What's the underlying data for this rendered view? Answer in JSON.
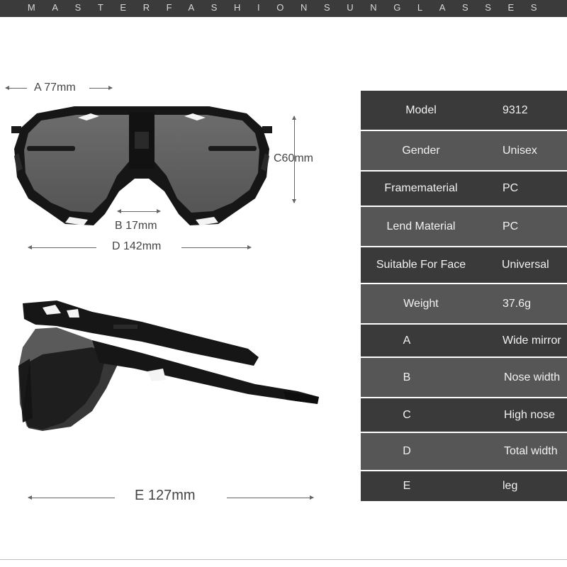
{
  "header": {
    "brand": "MASTERFASHIONSUNGLASSES",
    "band_color": "#3b3b3b"
  },
  "dimensions": {
    "a": "A 77mm",
    "b": "B 17mm",
    "c": "C60mm",
    "d": "D 142mm",
    "e": "E 127mm"
  },
  "specs": [
    {
      "key": "Model",
      "value": "9312"
    },
    {
      "key": "Gender",
      "value": "Unisex"
    },
    {
      "key": "Framematerial",
      "value": "PC"
    },
    {
      "key": "Lend Material",
      "value": "PC"
    },
    {
      "key": "Suitable For Face",
      "value": "Universal"
    },
    {
      "key": "Weight",
      "value": "37.6g"
    },
    {
      "key": "A",
      "value": "Wide mirror"
    },
    {
      "key": "B",
      "value": "Nose width"
    },
    {
      "key": "C",
      "value": "High nose"
    },
    {
      "key": "D",
      "value": "Total width"
    },
    {
      "key": "E",
      "value": "leg"
    }
  ],
  "colors": {
    "row_dark": "#3a3a3a",
    "row_light": "#565656",
    "frame": "#151515",
    "lens": "#5f5f5f"
  }
}
